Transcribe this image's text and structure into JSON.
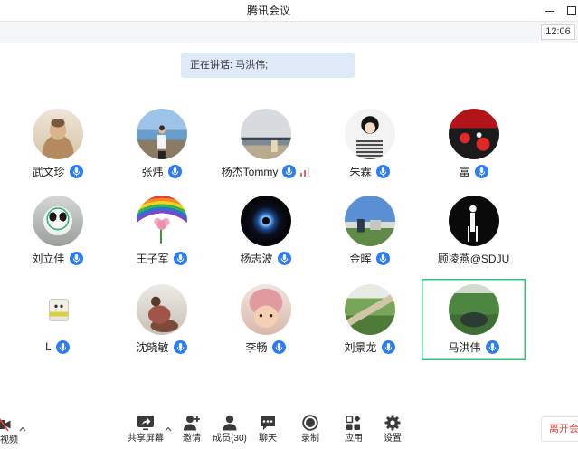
{
  "window": {
    "title": "腾讯会议",
    "minimize_icon": "minimize-icon",
    "maximize_icon": "maximize-icon"
  },
  "status_bar": {
    "time": "12:06"
  },
  "speaking": {
    "text": "正在讲话: 马洪伟;"
  },
  "participants": [
    {
      "name": "武文珍",
      "mic": true
    },
    {
      "name": "张炜",
      "mic": true
    },
    {
      "name": "杨杰Tommy",
      "mic": true,
      "signal": true
    },
    {
      "name": "朱霖",
      "mic": true
    },
    {
      "name": "富",
      "mic": true
    },
    {
      "name": "刘立佳",
      "mic": true
    },
    {
      "name": "王子军",
      "mic": true
    },
    {
      "name": "杨志波",
      "mic": true
    },
    {
      "name": "金晖",
      "mic": true
    },
    {
      "name": "顾凌燕@SDJU",
      "mic": false
    },
    {
      "name": "L",
      "mic": true
    },
    {
      "name": "沈晓敏",
      "mic": true
    },
    {
      "name": "李畅",
      "mic": true
    },
    {
      "name": "刘景龙",
      "mic": true
    },
    {
      "name": "马洪伟",
      "mic": true,
      "active_speaker": true
    }
  ],
  "toolbar": {
    "video": {
      "label": "视频",
      "icon": "video-off-icon"
    },
    "share": {
      "label": "共享屏幕",
      "icon": "share-screen-icon"
    },
    "invite": {
      "label": "邀请",
      "icon": "invite-icon"
    },
    "members": {
      "label": "成员(30)",
      "icon": "members-icon"
    },
    "chat": {
      "label": "聊天",
      "icon": "chat-icon"
    },
    "record": {
      "label": "录制",
      "icon": "record-icon"
    },
    "apps": {
      "label": "应用",
      "icon": "apps-icon"
    },
    "settings": {
      "label": "设置",
      "icon": "settings-icon"
    },
    "leave": {
      "label": "离开会"
    }
  },
  "colors": {
    "mic_icon": "#2d7cf6",
    "active_speaker_border": "#37c17f",
    "leave_text": "#e0443e",
    "speaking_banner": "#dfe9f8",
    "signal_bars": "#e5676b"
  }
}
